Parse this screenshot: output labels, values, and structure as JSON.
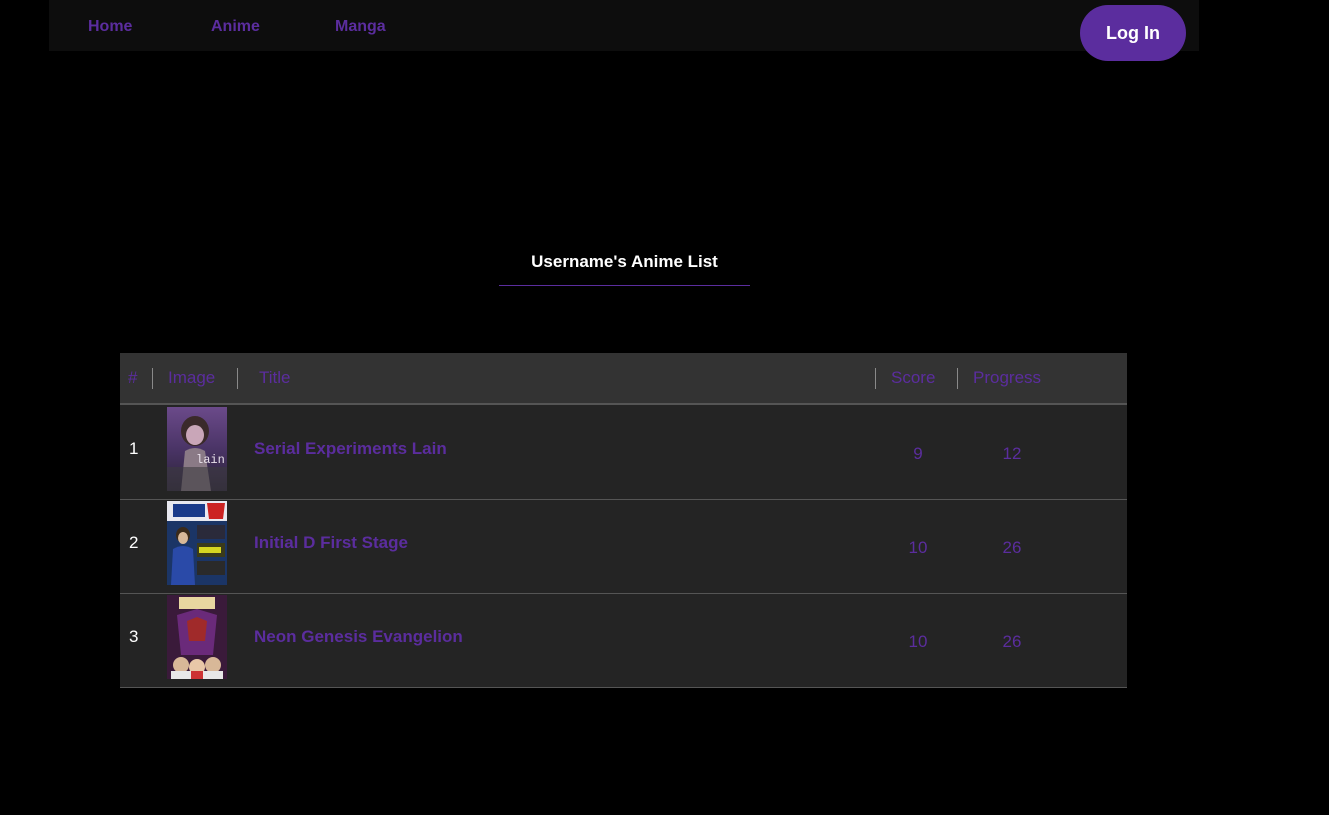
{
  "nav": {
    "links": [
      {
        "label": "Home"
      },
      {
        "label": "Anime"
      },
      {
        "label": "Manga"
      }
    ],
    "login_label": "Log In"
  },
  "list": {
    "heading": "Username's Anime List",
    "columns": {
      "num": "#",
      "image": "Image",
      "title": "Title",
      "score": "Score",
      "progress": "Progress"
    },
    "rows": [
      {
        "num": "1",
        "title": "Serial Experiments Lain",
        "score": "9",
        "progress": "12",
        "cover_text": "lain"
      },
      {
        "num": "2",
        "title": "Initial D First Stage",
        "score": "10",
        "progress": "26"
      },
      {
        "num": "3",
        "title": "Neon Genesis Evangelion",
        "score": "10",
        "progress": "26"
      }
    ]
  },
  "colors": {
    "accent": "#5b2d9e",
    "background": "#000000",
    "nav_background": "#0d0d0d",
    "table_header": "#333333",
    "table_row": "#242424"
  }
}
